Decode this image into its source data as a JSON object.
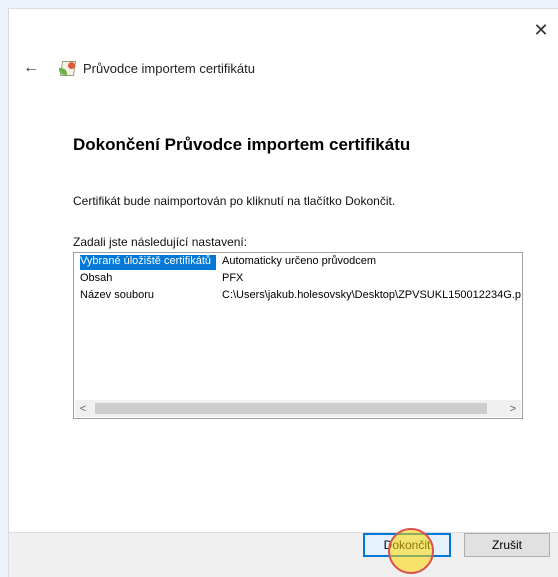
{
  "window": {
    "title": "Průvodce importem certifikátu",
    "close_label": "✕",
    "back_label": "←"
  },
  "page": {
    "heading": "Dokončení Průvodce importem certifikátu",
    "description": "Certifikát bude naimportován po kliknutí na tlačítko Dokončit.",
    "settings_label": "Zadali jste následující nastavení:"
  },
  "settings": [
    {
      "key": "Vybrané úložiště certifikátů",
      "value": "Automaticky určeno průvodcem",
      "selected": true
    },
    {
      "key": "Obsah",
      "value": "PFX",
      "selected": false
    },
    {
      "key": "Název souboru",
      "value": "C:\\Users\\jakub.holesovsky\\Desktop\\ZPVSUKL150012234G.p",
      "selected": false
    }
  ],
  "scrollbar": {
    "left": "<",
    "right": ">"
  },
  "buttons": {
    "finish": "Dokončit",
    "cancel": "Zrušit"
  },
  "colors": {
    "accent": "#0078d7"
  }
}
